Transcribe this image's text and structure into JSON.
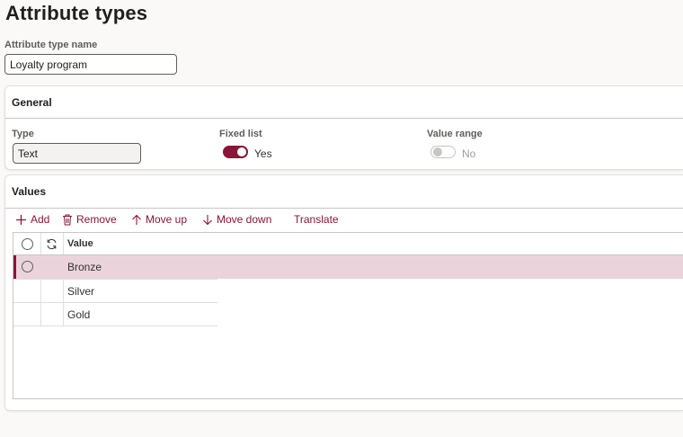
{
  "page": {
    "title": "Attribute types"
  },
  "attribute_type_name": {
    "label": "Attribute type name",
    "value": "Loyalty program"
  },
  "general": {
    "header": "General",
    "type": {
      "label": "Type",
      "value": "Text"
    },
    "fixed_list": {
      "label": "Fixed list",
      "state": "Yes",
      "on": true
    },
    "value_range": {
      "label": "Value range",
      "state": "No",
      "on": false,
      "disabled": true
    }
  },
  "values": {
    "header": "Values",
    "toolbar": {
      "add": "Add",
      "remove": "Remove",
      "move_up": "Move up",
      "move_down": "Move down",
      "translate": "Translate"
    },
    "grid": {
      "column_value": "Value",
      "rows": [
        "Bronze",
        "Silver",
        "Gold"
      ],
      "selected_index": 0
    }
  },
  "colors": {
    "accent": "#8a1538",
    "selected_row": "#ebd3dc",
    "background": "#faf9f8"
  },
  "icons": {
    "add": "plus-icon",
    "remove": "trash-icon",
    "move_up": "arrow-up-icon",
    "move_down": "arrow-down-icon",
    "refresh": "refresh-icon"
  }
}
